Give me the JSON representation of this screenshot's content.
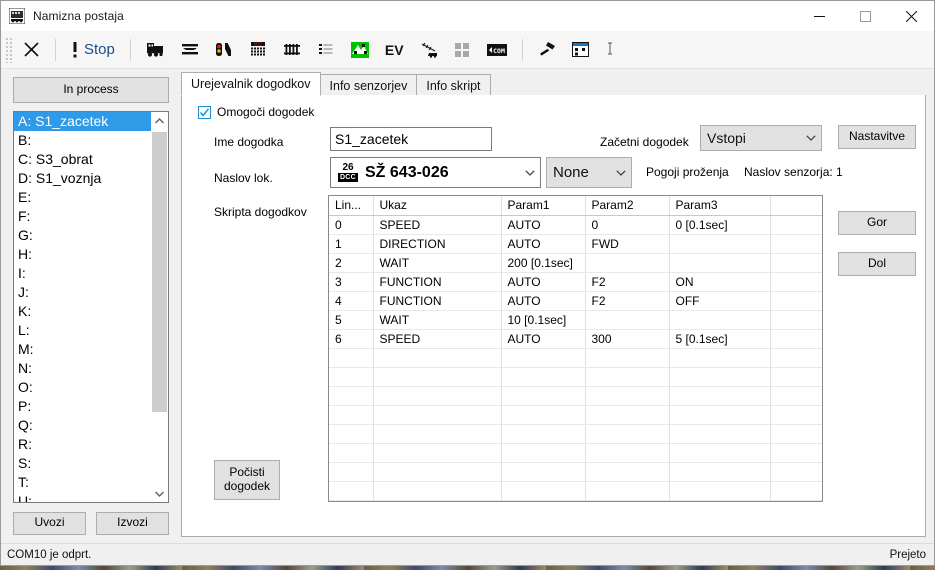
{
  "window": {
    "title": "Namizna postaja",
    "icon": "locomotive-icon",
    "minimize": "—",
    "maximize": "□",
    "close": "✕"
  },
  "toolbar": {
    "items": [
      {
        "name": "close-icon",
        "label": "",
        "kind": "x"
      },
      {
        "name": "stop-icon",
        "label": "Stop",
        "kind": "stop"
      },
      {
        "name": "locomotive-icon",
        "label": "",
        "kind": "loco"
      },
      {
        "name": "tracks-icon",
        "label": "",
        "kind": "tracks"
      },
      {
        "name": "signal-icon",
        "label": "",
        "kind": "signal"
      },
      {
        "name": "keypad-icon",
        "label": "",
        "kind": "keypad"
      },
      {
        "name": "turnout-icon",
        "label": "",
        "kind": "fence"
      },
      {
        "name": "list-icon",
        "label": "",
        "kind": "list"
      },
      {
        "name": "layout-icon",
        "label": "",
        "kind": "green"
      },
      {
        "name": "ev-icon",
        "label": "EV",
        "kind": "ev"
      },
      {
        "name": "crane-icon",
        "label": "",
        "kind": "crane"
      },
      {
        "name": "tiles-icon",
        "label": "",
        "kind": "tiles"
      },
      {
        "name": "com-icon",
        "label": "",
        "kind": "com"
      },
      {
        "name": "hammer-icon",
        "label": "",
        "kind": "hammer"
      },
      {
        "name": "window-icon",
        "label": "",
        "kind": "window"
      },
      {
        "name": "info-icon",
        "label": "",
        "kind": "info"
      }
    ]
  },
  "sidebar": {
    "in_process_label": "In process",
    "items": [
      {
        "label": "A: S1_zacetek",
        "selected": true
      },
      {
        "label": "B:",
        "selected": false
      },
      {
        "label": "C: S3_obrat",
        "selected": false
      },
      {
        "label": "D: S1_voznja",
        "selected": false
      },
      {
        "label": "E:",
        "selected": false
      },
      {
        "label": "F:",
        "selected": false
      },
      {
        "label": "G:",
        "selected": false
      },
      {
        "label": "H:",
        "selected": false
      },
      {
        "label": "I:",
        "selected": false
      },
      {
        "label": "J:",
        "selected": false
      },
      {
        "label": "K:",
        "selected": false
      },
      {
        "label": "L:",
        "selected": false
      },
      {
        "label": "M:",
        "selected": false
      },
      {
        "label": "N:",
        "selected": false
      },
      {
        "label": "O:",
        "selected": false
      },
      {
        "label": "P:",
        "selected": false
      },
      {
        "label": "Q:",
        "selected": false
      },
      {
        "label": "R:",
        "selected": false
      },
      {
        "label": "S:",
        "selected": false
      },
      {
        "label": "T:",
        "selected": false
      },
      {
        "label": "U:",
        "selected": false
      }
    ],
    "import_label": "Uvozi",
    "export_label": "Izvozi"
  },
  "main": {
    "tabs": [
      {
        "label": "Urejevalnik dogodkov",
        "active": true
      },
      {
        "label": "Info senzorjev",
        "active": false
      },
      {
        "label": "Info skript",
        "active": false
      }
    ],
    "enable_event": {
      "label": "Omogoči dogodek",
      "checked": true
    },
    "event_name": {
      "label": "Ime dogodka",
      "value": "S1_zacetek"
    },
    "loco_address": {
      "label": "Naslov lok.",
      "dcc_number": "26",
      "dcc_tag": "DCC",
      "value": "SŽ 643-026"
    },
    "none_combo": {
      "value": "None"
    },
    "start_event": {
      "label": "Začetni dogodek",
      "value": "Vstopi"
    },
    "settings_button": "Nastavitve",
    "trigger_conditions_label": "Pogoji proženja",
    "sensor_address_label": "Naslov senzorja: 1",
    "script_label": "Skripta dogodkov",
    "up_button": "Gor",
    "down_button": "Dol",
    "clear_button_line1": "Počisti",
    "clear_button_line2": "dogodek"
  },
  "script_table": {
    "columns": [
      "Lin...",
      "Ukaz",
      "Param1",
      "Param2",
      "Param3",
      ""
    ],
    "rows": [
      [
        "0",
        "SPEED",
        "AUTO",
        "0",
        "0 [0.1sec]",
        ""
      ],
      [
        "1",
        "DIRECTION",
        "AUTO",
        "FWD",
        "",
        ""
      ],
      [
        "2",
        "WAIT",
        "200 [0.1sec]",
        "",
        "",
        ""
      ],
      [
        "3",
        "FUNCTION",
        "AUTO",
        "F2",
        "ON",
        ""
      ],
      [
        "4",
        "FUNCTION",
        "AUTO",
        "F2",
        "OFF",
        ""
      ],
      [
        "5",
        "WAIT",
        "10 [0.1sec]",
        "",
        "",
        ""
      ],
      [
        "6",
        "SPEED",
        "AUTO",
        "300",
        "5 [0.1sec]",
        ""
      ],
      [
        "",
        "",
        "",
        "",
        "",
        ""
      ],
      [
        "",
        "",
        "",
        "",
        "",
        ""
      ],
      [
        "",
        "",
        "",
        "",
        "",
        ""
      ],
      [
        "",
        "",
        "",
        "",
        "",
        ""
      ],
      [
        "",
        "",
        "",
        "",
        "",
        ""
      ],
      [
        "",
        "",
        "",
        "",
        "",
        ""
      ],
      [
        "",
        "",
        "",
        "",
        "",
        ""
      ],
      [
        "",
        "",
        "",
        "",
        "",
        ""
      ]
    ]
  },
  "statusbar": {
    "left": "COM10 je odprt.",
    "right": "Prejeto"
  },
  "colors": {
    "accent_blue": "#2f9ae8",
    "toolbar_text_blue": "#1a4f8a",
    "green_icon": "#00c000",
    "stop_red": "#d00000"
  }
}
